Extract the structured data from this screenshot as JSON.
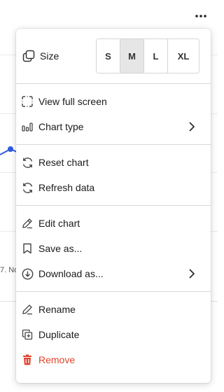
{
  "background": {
    "axis_label": "7. No"
  },
  "menu": {
    "size": {
      "label": "Size",
      "options": [
        "S",
        "M",
        "L",
        "XL"
      ],
      "selected": "M"
    },
    "sections": [
      {
        "items": [
          {
            "label": "View full screen",
            "icon": "fullscreen-icon",
            "submenu": false
          },
          {
            "label": "Chart type",
            "icon": "chart-type-icon",
            "submenu": true
          }
        ]
      },
      {
        "items": [
          {
            "label": "Reset chart",
            "icon": "reset-icon",
            "submenu": false
          },
          {
            "label": "Refresh data",
            "icon": "refresh-icon",
            "submenu": false
          }
        ]
      },
      {
        "items": [
          {
            "label": "Edit chart",
            "icon": "pencil-icon",
            "submenu": false
          },
          {
            "label": "Save as...",
            "icon": "bookmark-icon",
            "submenu": false
          },
          {
            "label": "Download as...",
            "icon": "download-icon",
            "submenu": true
          }
        ]
      },
      {
        "items": [
          {
            "label": "Rename",
            "icon": "rename-icon",
            "submenu": false
          },
          {
            "label": "Duplicate",
            "icon": "duplicate-icon",
            "submenu": false
          },
          {
            "label": "Remove",
            "icon": "trash-icon",
            "submenu": false,
            "danger": true
          }
        ]
      }
    ]
  },
  "colors": {
    "danger": "#e0442c",
    "series": "#2f5be0",
    "selected_size_bg": "#e6e6e6"
  }
}
